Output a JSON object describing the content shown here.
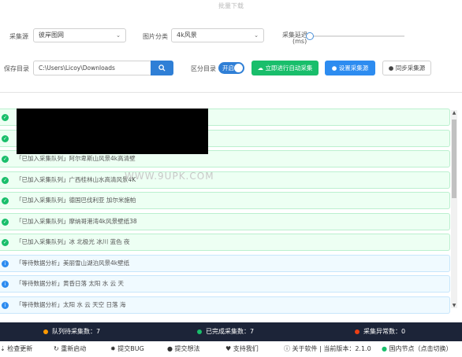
{
  "window": {
    "title": "批量下载"
  },
  "form": {
    "source_label": "采集源",
    "source_value": "彼岸图网",
    "category_label": "图片分类",
    "category_value": "4k风景",
    "delay_label_1": "采集延迟",
    "delay_label_2": "(ms)",
    "save_label": "保存目录",
    "save_path": "C:\\Users\\Licoy\\Downloads",
    "sub_dir_label": "区分目录",
    "toggle_text": "开启",
    "start_button": "立即进行自动采集",
    "set_source_button": "设置采集源",
    "sync_source_button": "同步采集源"
  },
  "log": [
    {
      "status": "ok",
      "text": ""
    },
    {
      "status": "ok",
      "text": ""
    },
    {
      "status": "ok",
      "text": "「已加入采集队列」阿尔卑斯山风景4k高清壁"
    },
    {
      "status": "ok",
      "text": "「已加入采集队列」广西桂林山水高清风景4K"
    },
    {
      "status": "ok",
      "text": "「已加入采集队列」德国巴伐利亚 加尔米施帕"
    },
    {
      "status": "ok",
      "text": "「已加入采集队列」摩纳哥港湾4k风景壁纸38"
    },
    {
      "status": "ok",
      "text": "「已加入采集队列」冰 北极光 冰川 蓝色 夜"
    },
    {
      "status": "wait",
      "text": "「等待数据分析」美丽雪山湖泊风景4k壁纸"
    },
    {
      "status": "wait",
      "text": "「等待数据分析」黄昏日落 太阳 水 云 天"
    },
    {
      "status": "wait",
      "text": "「等待数据分析」太阳 水 云 天空 日落 海"
    }
  ],
  "watermark": "WWW.9UPK.COM",
  "status_bar": {
    "queue": "队列待采集数：7",
    "done": "已完成采集数：7",
    "error": "采集异常数：0",
    "colors": {
      "queue": "#ff9900",
      "done": "#19be6b",
      "error": "#ed4014"
    }
  },
  "footer": {
    "check_update": "检查更新",
    "restart": "重新启动",
    "submit_bug": "提交BUG",
    "submit_idea": "提交想法",
    "support": "支持我们",
    "about": "关于软件 | 当前版本：2.1.0",
    "node": "国内节点（点击切换）"
  }
}
